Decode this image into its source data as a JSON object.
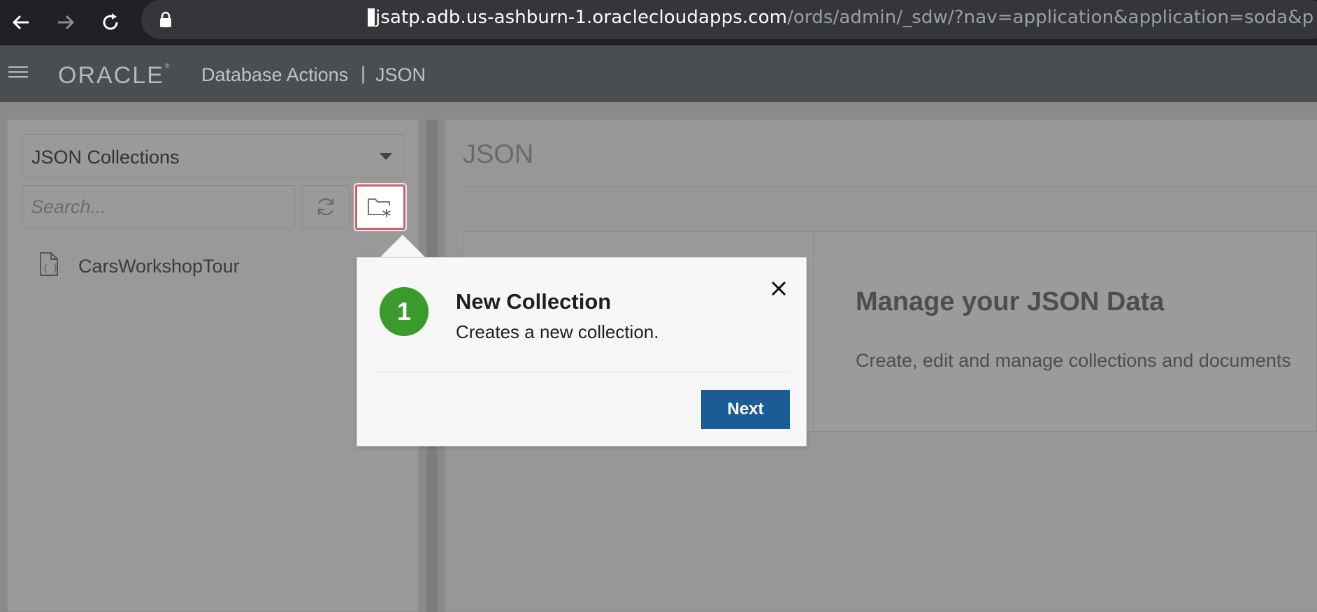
{
  "browser": {
    "url_host": "jsatp.adb.us-ashburn-1.oraclecloudapps.com",
    "url_path": "/ords/admin/_sdw/?nav=application&application=soda&p"
  },
  "header": {
    "logo_text": "ORACLE",
    "logo_mark": "®",
    "app_title": "Database Actions",
    "separator": "|",
    "section": "JSON"
  },
  "sidebar": {
    "collections_select": "JSON Collections",
    "search_placeholder": "Search...",
    "items": [
      {
        "label": "CarsWorkshopTour"
      }
    ]
  },
  "main": {
    "title": "JSON",
    "intro_heading": "Manage your JSON Data",
    "intro_text": "Create, edit and manage collections and documents"
  },
  "popover": {
    "step": "1",
    "title": "New Collection",
    "description": "Creates a new collection.",
    "next_label": "Next"
  },
  "colors": {
    "header_bg": "#4a4e52",
    "overlay": "#999999",
    "step_badge": "#3a9a2c",
    "next_button": "#1b5b96",
    "highlight_border": "#c9646e"
  }
}
